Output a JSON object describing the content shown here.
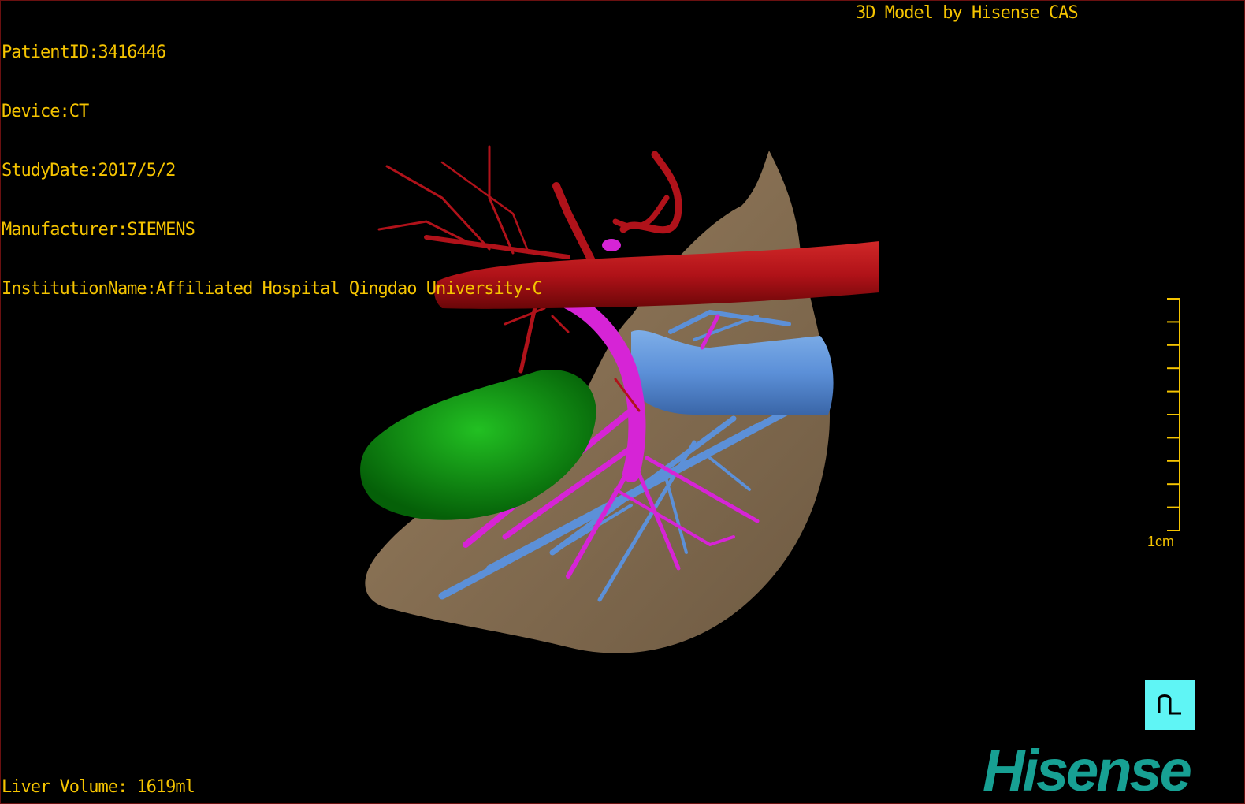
{
  "info": {
    "patient_id": "PatientID:3416446",
    "device": "Device:CT",
    "study_date": "StudyDate:2017/5/2",
    "manufacturer": "Manufacturer:SIEMENS",
    "institution": "InstitutionName:Affiliated Hospital Qingdao University-C"
  },
  "brand_text": "3D Model by Hisense CAS",
  "liver_volume": "Liver Volume: 1619ml",
  "scale_bar": {
    "label": "1cm",
    "ticks": 10
  },
  "orientation_button": {
    "icon": "orientation-cube-icon"
  },
  "logo": "Hisense",
  "colors": {
    "text": "#f5c400",
    "liver": "#8a7254",
    "artery": "#b0121a",
    "portal_vein": "#d624d6",
    "hepatic_vein": "#5c90d8",
    "gallbladder": "#0c8c10",
    "logo": "#17a093",
    "orientation_button": "#5ff5f5"
  }
}
